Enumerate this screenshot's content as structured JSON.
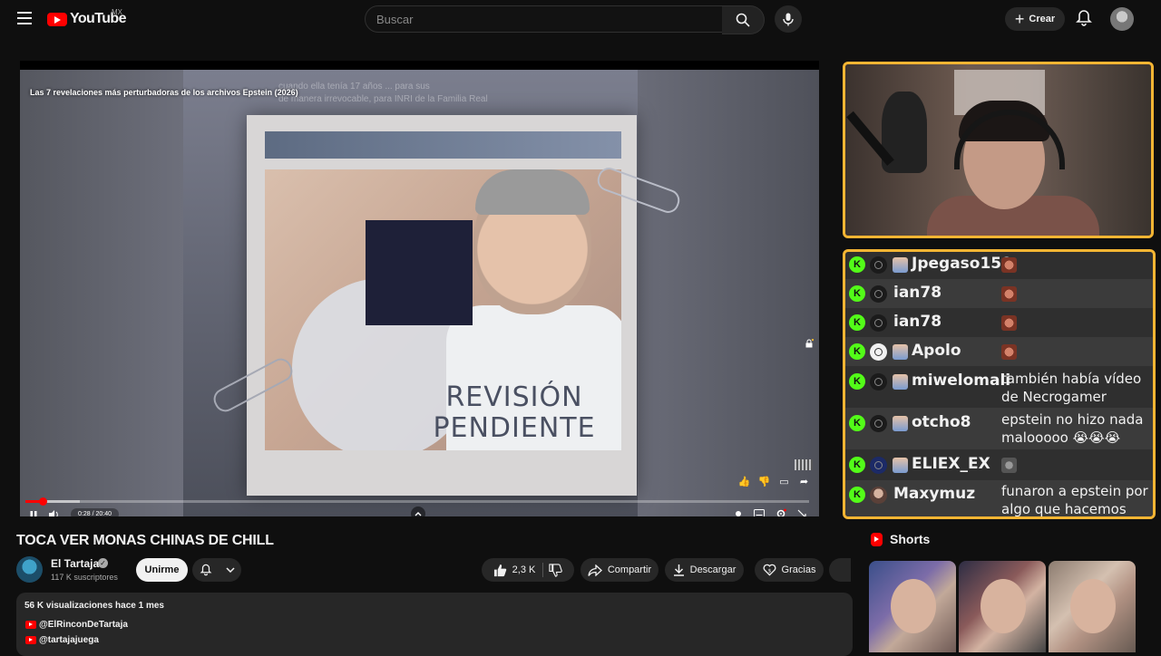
{
  "header": {
    "logo_text": "YouTube",
    "country_code": "MX",
    "search_placeholder": "Buscar",
    "create_label": "Crear"
  },
  "player": {
    "overlay_title": "Las 7 revelaciones más perturbadoras de los archivos Epstein (2026)",
    "overlay_caption_1": "cuando ella tenía 17 años ... para sus",
    "overlay_caption_2": "de manera irrevocable, para INRI de la Familia Real",
    "stamp_line_1": "REVISIÓN",
    "stamp_line_2": "PENDIENTE",
    "time_display": "0:28 / 20:40",
    "progress": 0.023,
    "buffered": 0.07
  },
  "chat": {
    "messages": [
      {
        "user": "Jpegaso159",
        "text": "",
        "emote": true,
        "sub": true
      },
      {
        "user": "ian78",
        "text": "",
        "emote": true,
        "sub": false
      },
      {
        "user": "ian78",
        "text": "",
        "emote": true,
        "sub": false
      },
      {
        "user": "Apolo",
        "text": "",
        "emote": true,
        "sub": true
      },
      {
        "user": "miwelomali",
        "text": "también había vídeo de Necrogamer",
        "emote": false,
        "sub": true
      },
      {
        "user": "otcho8",
        "text": "epstein no hizo nada malooooo 😭😭😭",
        "emote": false,
        "sub": true
      },
      {
        "user": "ELIEX_EX",
        "text": "",
        "emote": true,
        "sub": true
      },
      {
        "user": "Maxymuz",
        "text": "funaron a epstein por algo que hacemos todos",
        "emote": false,
        "sub": false
      }
    ]
  },
  "video": {
    "title": "TOCA VER MONAS CHINAS DE CHILL",
    "channel_name": "El Tartaja",
    "subscribers": "117 K suscriptores",
    "join_label": "Unirme",
    "likes": "2,3 K",
    "share_label": "Compartir",
    "download_label": "Descargar",
    "thanks_label": "Gracias"
  },
  "description": {
    "stats": "56 K visualizaciones  hace 1 mes",
    "links": [
      "@ElRinconDeTartaja",
      "@tartajajuega"
    ]
  },
  "shorts": {
    "heading": "Shorts"
  },
  "colors": {
    "accent_border": "#f5b533",
    "kick_green": "#53fc18",
    "youtube_red": "#ff0000"
  }
}
